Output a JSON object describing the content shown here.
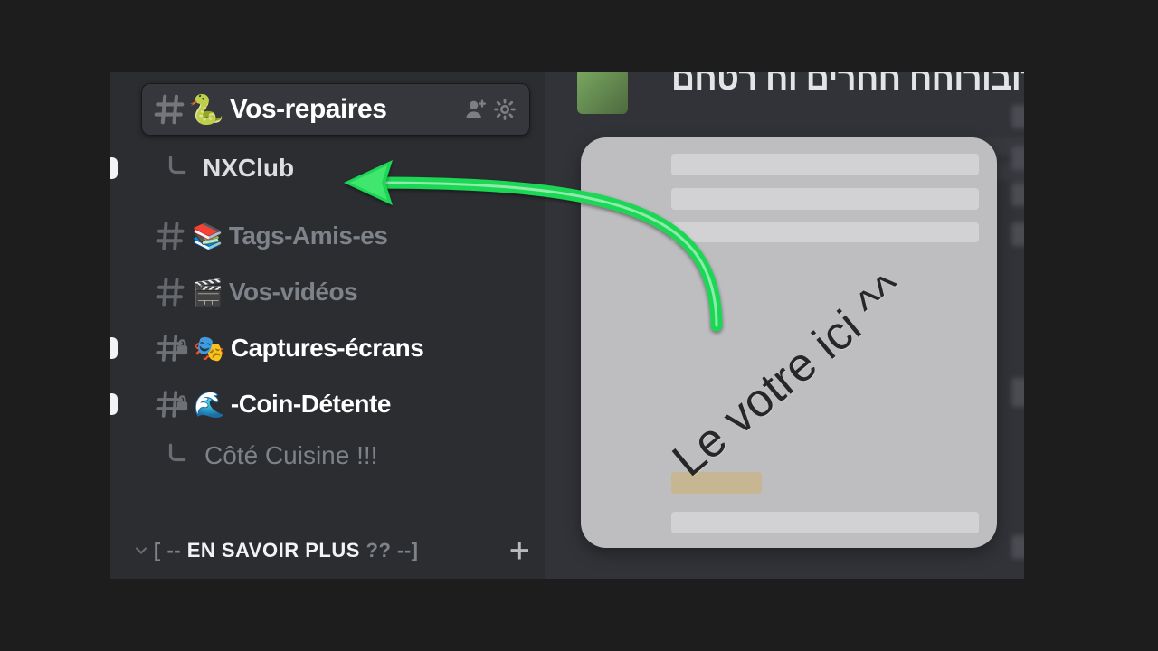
{
  "header": {
    "emoji": "🐍",
    "title": "Vos-repaires"
  },
  "thread": {
    "label": "NXClub"
  },
  "channels": [
    {
      "emoji": "📚",
      "label": "Tags-Amis-es",
      "unread": false,
      "locked": false,
      "pill": false
    },
    {
      "emoji": "🎬",
      "label": "Vos-vidéos",
      "unread": false,
      "locked": false,
      "pill": false
    },
    {
      "emoji": "🎭",
      "label": "Captures-écrans",
      "unread": true,
      "locked": true,
      "pill": true
    },
    {
      "emoji": "🌊",
      "label": "-Coin-Détente",
      "unread": true,
      "locked": true,
      "pill": true
    }
  ],
  "subthread": {
    "label": "Côté Cuisine !!!"
  },
  "category": {
    "pre": "[ -- ",
    "bold": "EN SAVOIR PLUS",
    "post": " ?? --]"
  },
  "chat": {
    "truncated_message": "בורב מרובורוחח חחרים וח רטחם"
  },
  "note": {
    "text": "Le votre ici ^^"
  },
  "colors": {
    "arrow": "#1fd655"
  }
}
